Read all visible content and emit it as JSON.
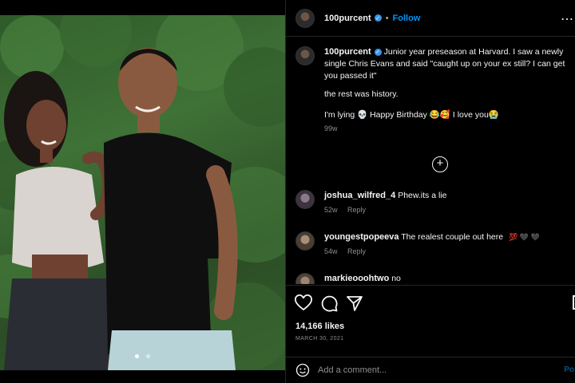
{
  "header": {
    "username": "100purcent",
    "verified_mark": "✓",
    "separator": "•",
    "follow_label": "Follow",
    "more_icon": "ellipsis-icon"
  },
  "caption": {
    "username": "100purcent",
    "line1": "Junior year preseason at Harvard. I saw a newly single Chris Evans and said \"caught up on your ex still? I can get you passed it\"",
    "line2": "the rest was history.",
    "line3": "I'm lying 💀 Happy Birthday 😂🥰 I love you😭",
    "time": "99w"
  },
  "load_more_icon": "plus-circle-icon",
  "comments": [
    {
      "username": "joshua_wilfred_4",
      "text": "Phew.its a lie",
      "time": "52w",
      "reply": "Reply"
    },
    {
      "username": "youngestpopeeva",
      "text": "The realest couple out here",
      "emojis": "💯 🖤 🖤",
      "time": "54w",
      "reply": "Reply"
    },
    {
      "username": "markieooohtwo",
      "text": "no"
    }
  ],
  "actions": {
    "like_icon": "heart-icon",
    "comment_icon": "comment-icon",
    "share_icon": "share-icon",
    "save_icon": "bookmark-icon",
    "likes": "14,166 likes",
    "date": "MARCH 30, 2021"
  },
  "composer": {
    "emoji_icon": "emoji-icon",
    "placeholder": "Add a comment...",
    "post_label": "Po"
  },
  "colors": {
    "link": "#0095f6",
    "muted": "#8e8e8e",
    "background": "#000000"
  }
}
